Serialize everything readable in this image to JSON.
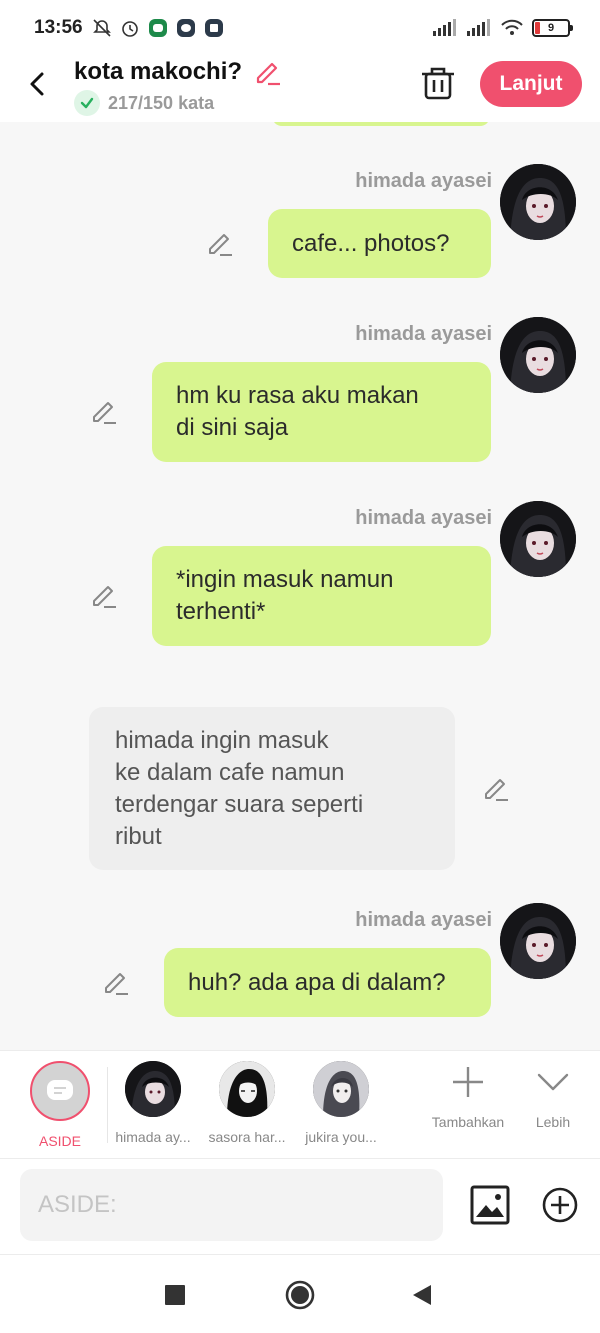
{
  "status_bar": {
    "time": "13:56",
    "battery": "9",
    "left_icons": [
      "bell-off-icon",
      "alarm-icon",
      "android-app-icon",
      "chat-app-icon",
      "media-app-icon"
    ],
    "right_icons": [
      "signal-icon",
      "signal-icon",
      "wifi-icon",
      "battery-icon"
    ]
  },
  "header": {
    "title": "kota makochi?",
    "word_count": "217/150 kata",
    "next_label": "Lanjut",
    "accent": "#f0506e"
  },
  "messages": [
    {
      "type": "user",
      "sender": "himada ayasei",
      "text": "cafe... photos?"
    },
    {
      "type": "user",
      "sender": "himada ayasei",
      "text": "hm ku rasa aku makan\ndi sini saja"
    },
    {
      "type": "user",
      "sender": "himada ayasei",
      "text": "*ingin masuk namun\nterhenti*"
    },
    {
      "type": "aside",
      "text": "himada ingin masuk\nke dalam cafe namun\nterdengar suara seperti\nribut"
    },
    {
      "type": "user",
      "sender": "himada ayasei",
      "text": "huh? ada apa di dalam?"
    }
  ],
  "characters": {
    "aside_label": "ASIDE",
    "items": [
      {
        "label": "himada ay..."
      },
      {
        "label": "sasora har..."
      },
      {
        "label": "jukira you..."
      }
    ],
    "add_label": "Tambahkan",
    "more_label": "Lebih"
  },
  "composer": {
    "placeholder": "ASIDE:"
  },
  "colors": {
    "bubble_green": "#d8f58f",
    "bubble_grey": "#eeeeee",
    "accent": "#f0506e"
  }
}
